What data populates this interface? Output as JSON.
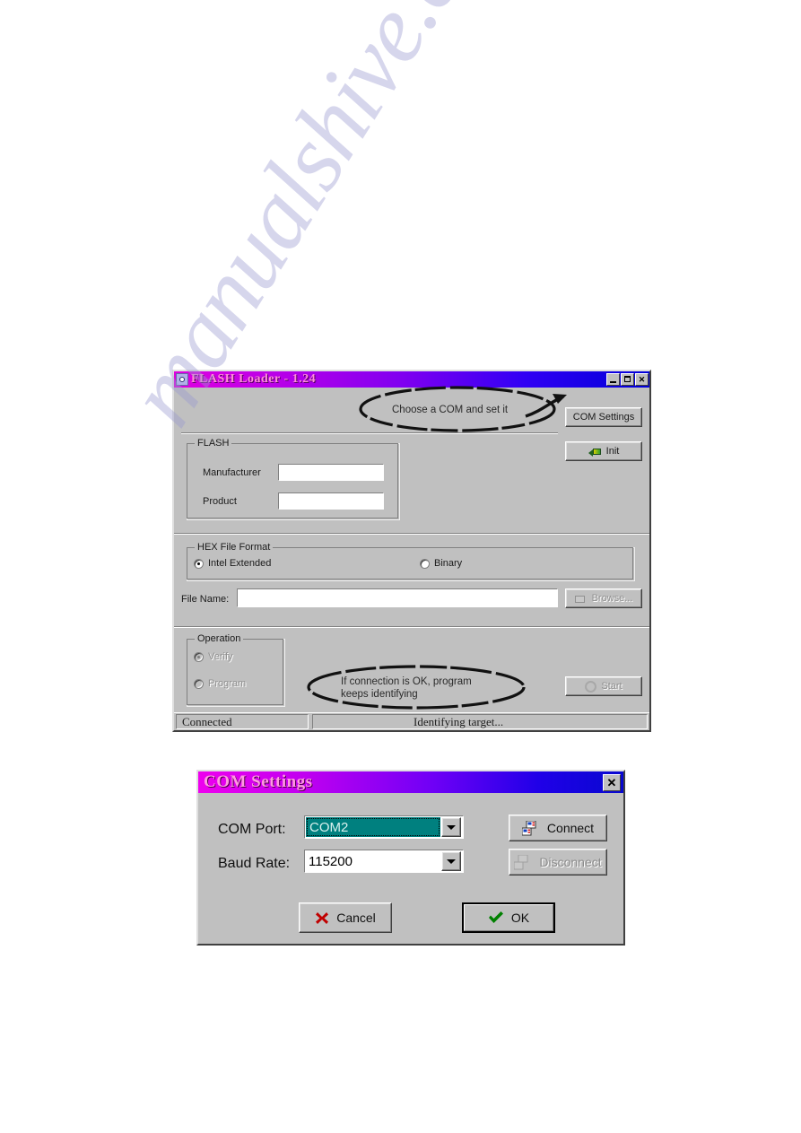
{
  "page": {
    "watermark": "manualshive.com"
  },
  "flash_window": {
    "title": "FLASH Loader - 1.24",
    "icon": "app-icon",
    "window_buttons": {
      "minimize": "minimize-icon",
      "maximize": "maximize-icon",
      "close": "✕"
    },
    "buttons": {
      "com_settings": "COM Settings",
      "init": "Init",
      "browse": "Browse...",
      "start": "Start"
    },
    "flash_group": {
      "legend": "FLASH",
      "manufacturer_label": "Manufacturer",
      "manufacturer_value": "",
      "product_label": "Product",
      "product_value": ""
    },
    "hex_group": {
      "legend": "HEX File Format",
      "options": [
        {
          "label": "Intel Extended",
          "checked": true
        },
        {
          "label": "Binary",
          "checked": false
        }
      ]
    },
    "file_row": {
      "label": "File Name:",
      "value": ""
    },
    "operation_group": {
      "legend": "Operation",
      "options": [
        {
          "label": "Verify",
          "checked": true,
          "disabled": true
        },
        {
          "label": "Program",
          "checked": false,
          "disabled": true
        }
      ]
    },
    "statusbar": {
      "pane1": "Connected",
      "pane2": "Identifying target..."
    },
    "annotations": [
      {
        "text": "Choose a COM and set it"
      },
      {
        "text": "If connection is OK, program\nkeeps identifying"
      }
    ]
  },
  "com_dialog": {
    "title": "COM Settings",
    "close_label": "✕",
    "com_port_label": "COM Port:",
    "com_port_value": "COM2",
    "baud_rate_label": "Baud Rate:",
    "baud_rate_value": "115200",
    "connect_label": "Connect",
    "disconnect_label": "Disconnect",
    "cancel_label": "Cancel",
    "ok_label": "OK"
  },
  "colors": {
    "face": "#c0c0c0",
    "title_start": "#ee00ee",
    "title_end": "#0000d8",
    "title_text": "#ff8cd8",
    "selection": "#00807f",
    "ok_check": "#008000",
    "cancel_x": "#c00000"
  }
}
